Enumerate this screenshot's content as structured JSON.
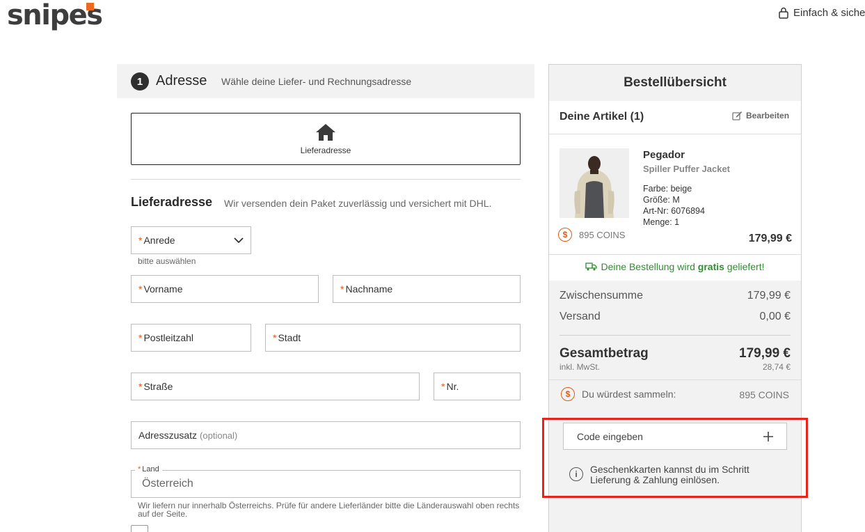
{
  "header": {
    "logo_text": "snipes",
    "secure_text": "Einfach & sicher"
  },
  "step": {
    "number": "1",
    "title": "Adresse",
    "subtitle": "Wähle deine Liefer- und Rechnungsadresse"
  },
  "address_card": {
    "label": "Lieferadresse"
  },
  "delivery": {
    "title": "Lieferadresse",
    "subtitle": "Wir versenden dein Paket zuverlässig und versichert mit DHL."
  },
  "form": {
    "required_mark": "*",
    "salutation": {
      "label": "Anrede",
      "hint": "bitte auswählen"
    },
    "first_name": "Vorname",
    "last_name": "Nachname",
    "postal_code": "Postleitzahl",
    "city": "Stadt",
    "street": "Straße",
    "number": "Nr.",
    "address_extra": {
      "label": "Adresszusatz",
      "optional": "(optional)"
    },
    "country": {
      "label": "Land",
      "value": "Österreich",
      "hint": "Wir liefern nur innerhalb Österreichs. Prüfe für andere Lieferländer bitte die Länderauswahl oben rechts auf der Seite."
    }
  },
  "summary": {
    "title": "Bestellübersicht",
    "items_label": "Deine Artikel (1)",
    "edit_label": "Bearbeiten",
    "product": {
      "brand": "Pegador",
      "name": "Spiller Puffer Jacket",
      "color": "Farbe: beige",
      "size": "Größe: M",
      "article": "Art-Nr: 6076894",
      "quantity": "Menge: 1",
      "coins": "895 COINS",
      "price": "179,99 €"
    },
    "free_shipping": {
      "pre": "Deine Bestellung wird ",
      "bold": "gratis",
      "post": " geliefert!"
    },
    "subtotal_label": "Zwischensumme",
    "subtotal_value": "179,99 €",
    "shipping_label": "Versand",
    "shipping_value": "0,00 €",
    "total_label": "Gesamtbetrag",
    "total_value": "179,99 €",
    "tax_label": "inkl. MwSt.",
    "tax_value": "28,74 €",
    "collect_label": "Du würdest sammeln:",
    "collect_value": "895 COINS",
    "code_placeholder": "Code eingeben",
    "gift_info": "Geschenkkarten kannst du im Schritt Lieferung & Zahlung einlösen."
  },
  "icons": {
    "lock": "lock-icon",
    "home": "home-icon",
    "chevron": "chevron-down-icon",
    "edit": "edit-icon",
    "coin": "coin-icon",
    "truck": "truck-icon",
    "plus": "plus-icon",
    "info": "info-icon"
  },
  "colors": {
    "accent": "#ec6a1f",
    "success": "#2e8f2e",
    "highlight": "#e8231b"
  }
}
